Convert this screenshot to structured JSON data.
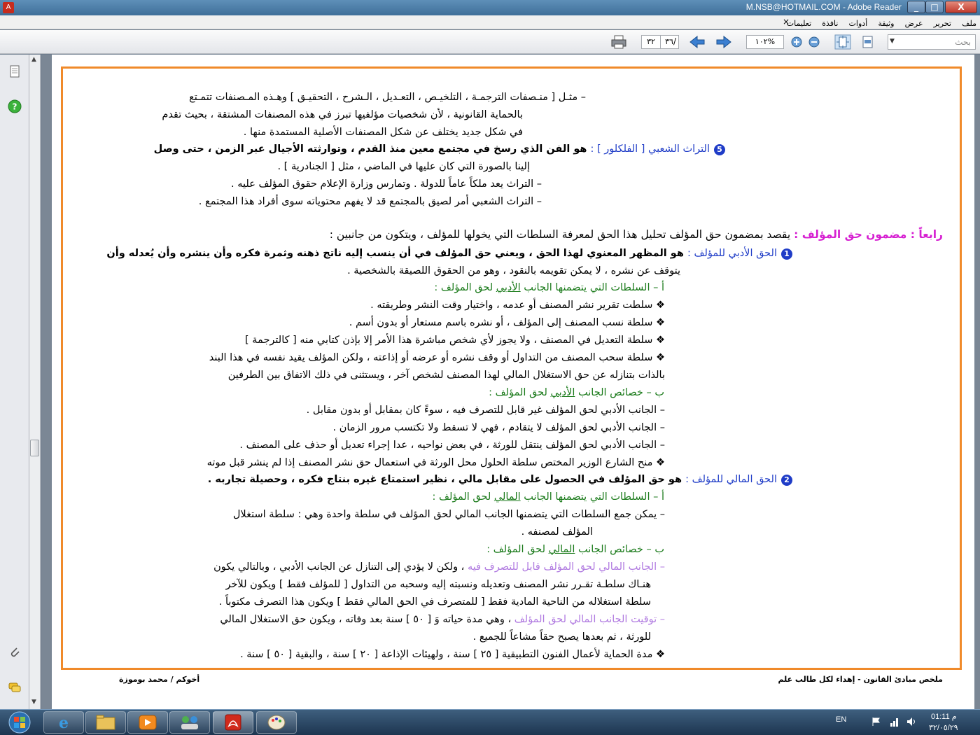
{
  "window": {
    "title": "M.NSB@HOTMAIL.COM - Adobe Reader",
    "controls": {
      "minimize": "_",
      "maximize": "□",
      "close": "X"
    }
  },
  "menu": {
    "items": [
      "ملف",
      "تحرير",
      "عرض",
      "وثيقة",
      "أدوات",
      "نافذة",
      "تعليمات"
    ],
    "close_doc": "×"
  },
  "toolbar": {
    "search_placeholder": "بحث",
    "current_page": "٣٢",
    "page_separator": "/",
    "total_pages": "٣٦",
    "zoom": "١٠٢%"
  },
  "content": {
    "l1": "–   مثـل [ منـصفات الترجمـة ، التلخيـص ، التعـديل ، الـشرح ، التحقيـق ] وهـذه المـصنفات تتمـتع",
    "l2": "بالحماية القانونية ، لأن شخصيات مؤلفيها تبرز في هذه المصنفات المشتقة ، بحيث تقدم",
    "l3": "في شكل جديد يختلف عن شكل المصنفات الأصلية المستمدة منها .",
    "s5_num": "5",
    "s5_title": "التراث الشعبي [ الفلكلور ] :",
    "s5_text": " هو الفن الذي رسخ في مجتمع معين منذ القدم ، وتوارثته الأجيال عبر الزمن ، حتى وصل",
    "l5b": "إلينا بالصورة التي كان عليها في الماضي ، مثل [ الجنادرية ] .",
    "l6": "–   التراث يعد ملكاً عاماً للدولة . وتمارس وزارة الإعلام حقوق المؤلف عليه .",
    "l7": "–   التراث الشعبي أمر لصيق بالمجتمع قد لا يفهم محتوياته سوى أفراد هذا المجتمع .",
    "h4_title": "رابعاً : مضمون حق المؤلف :",
    "h4_text": " يقصد بمضمون حق المؤلف تحليل هذا الحق لمعرفة السلطات التي يخولها للمؤلف ، ويتكون من جانبين :",
    "s1_num": "1",
    "s1_title": "الحق الأدبي للمؤلف :",
    "s1_text": " هو المظهر المعنوي لهذا الحق ، ويعني حق المؤلف في أن ينسب إليه ناتج ذهنه وثمرة فكره وأن ينشره وأن يُعدله وأن",
    "s1_b": "يتوقف عن نشره ، لا يمكن تقويمه بالنقود ، وهو من الحقوق اللصيقة بالشخصية .",
    "a1_prefix": "أ – السلطات التي يتضمنها الجانب ",
    "a1_under": "الأدبي",
    "a1_suffix": " لحق المؤلف :",
    "b1": "❖ سلطت تقرير نشر المصنف أو عدمه ، واختيار وقت النشر وطريقته .",
    "b2": "❖ سلطة نسب المصنف إلى المؤلف ، أو نشره باسم مستعار أو بدون أسم .",
    "b3": "❖ سلطة التعديل في المصنف ، ولا يجوز لأي شخص مباشرة هذا الأمر إلا بإذن كتابي منه [ كالترجمة ]",
    "b4": "❖ سلطة سحب المصنف من التداول أو وقف نشره أو عرضه أو إذاعته ، ولكن المؤلف يقيد نفسه في هذا البند",
    "b4b": "بالذات بتنازله عن حق الاستغلال المالي لهذا المصنف لشخص آخر ، ويستثنى في ذلك الاتفاق بين الطرفين",
    "bh1_prefix": "ب – خصائص الجانب ",
    "bh1_under": "الأدبي",
    "bh1_suffix": " لحق المؤلف :",
    "c1": "–   الجانب الأدبي لحق المؤلف غير قابل للتصرف فيه ، سوءً كان بمقابل أو بدون مقابل .",
    "c2": "–   الجانب الأدبي لحق المؤلف لا يتقادم ، فهي لا تسقط ولا تكتسب مرور الزمان .",
    "c3": "–   الجانب الأدبي لحق المؤلف ينتقل للورثة ، في بعض نواحيه ، عدا إجراء تعديل أو حذف على المصنف .",
    "c4": "❖   منح الشارع الوزير المختص سلطة الحلول محل الورثة في استعمال حق نشر المصنف إذا لم ينشر قبل موته",
    "s2_num": "2",
    "s2_title": "الحق المالي للمؤلف :",
    "s2_text": " هو حق المؤلف في الحصول على مقابل مالي ، نظير استمتاع غيره بنتاج فكره ، وحصيلة تجاربه .",
    "a2_prefix": "أ – السلطات التي يتضمنها الجانب ",
    "a2_under": "المالي",
    "a2_suffix": " لحق المؤلف :",
    "d1": "–   يمكن جمع السلطات التي يتضمنها الجانب المالي لحق المؤلف في سلطة واحدة وهي : سلطة استغلال",
    "d1b": "المؤلف لمصنفه .",
    "bh2_prefix": "ب – خصائص الجانب ",
    "bh2_under": "المالي",
    "bh2_suffix": " لحق المؤلف :",
    "e1_colored": "–   الجانب المالي لحق المؤلف قابل للتصرف فيه",
    "e1_text": " ، ولكن لا يؤدي إلى التنازل عن الجانب الأدبي ، وبالتالي يكون",
    "e1b": "هنـاك سلطـة تقـرر نشر المصنف وتعديله ونسبته إليه وسحبه من التداول [ للمؤلف فقط ] ويكون للآخر",
    "e1c": "سلطة استغلاله من الناحية المادية فقط [ للمتصرف في الحق المالي فقط ] ويكون هذا التصرف مكتوباً .",
    "e2_colored": "–   توقيت الجانب المالي لحق المؤلف",
    "e2_text": " ، وهي مدة حياته وَ [ ٥٠ ] سنة بعد وفاته ، ويكون حق الاستغلال المالي",
    "e2b": "للورثة ، ثم بعدها يصبح حقاً مشاعاً للجميع .",
    "e3": "❖ مدة الحماية لأعمال الفنون التطبيقية [ ٢٥ ] سنة ، ولهيئات الإذاعة [ ٢٠ ] سنة ، والبقية [ ٥٠ ] سنة ."
  },
  "footer": {
    "right": "ملخص مبادئ القانون  -  إهداء لكل طالب علم",
    "left": "أخوكم / محمد بوموزة"
  },
  "taskbar": {
    "lang": "EN",
    "time": "01:11 م",
    "date": "٣٢/٠٥/٢٩"
  }
}
